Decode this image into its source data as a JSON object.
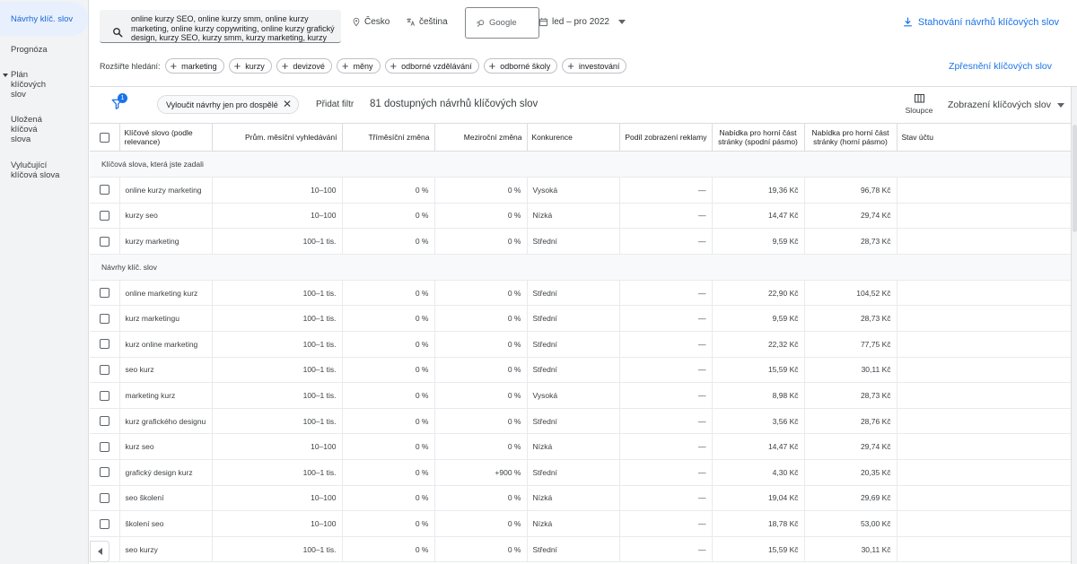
{
  "sidebar": {
    "items": [
      {
        "label": "Návrhy klíč. slov",
        "active": true
      },
      {
        "label": "Prognóza"
      },
      {
        "label": "Plán klíčových slov"
      },
      {
        "label": "Uložená klíčová slova"
      },
      {
        "label": "Vylučující klíčová slova"
      }
    ]
  },
  "header": {
    "keywords": "online kurzy SEO, online kurzy smm, online kurzy marketing, online kurzy copywriting, online kurzy grafický design, kurzy SEO, kurzy smm, kurzy marketing, kurzy",
    "location": "Česko",
    "language": "čeština",
    "network": "Google",
    "date_range": "led – pro 2022",
    "download": "Stahování návrhů klíčových slov",
    "broaden_label": "Rozšiřte hledání:",
    "broaden_chips": [
      "marketing",
      "kurzy",
      "devizové",
      "měny",
      "odborné vzdělávání",
      "odborné školy",
      "investování"
    ],
    "refine": "Zpřesnění klíčových slov"
  },
  "toolbar": {
    "filter_badge": "1",
    "adult_filter": "Vyloučit návrhy jen pro dospělé",
    "add_filter": "Přidat filtr",
    "available": "81 dostupných návrhů klíčových slov",
    "columns": "Sloupce",
    "view": "Zobrazení klíčových slov"
  },
  "table": {
    "headers": {
      "keyword": "Klíčové slovo (podle relevance)",
      "avg": "Prům. měsíční vyhledávání",
      "three_month": "Tříměsíční změna",
      "yoy": "Meziroční změna",
      "competition": "Konkurence",
      "share": "Podíl zobrazení reklamy",
      "bid_low": "Nabídka pro horní část stránky (spodní pásmo)",
      "bid_high": "Nabídka pro horní část stránky (horní pásmo)",
      "status": "Stav účtu"
    },
    "section_entered": "Klíčová slova, která jste zadali",
    "entered_rows": [
      {
        "kw": "online kurzy marketing",
        "avg": "10–100",
        "three": "0 %",
        "yoy": "0 %",
        "comp": "Vysoká",
        "share": "—",
        "low": "19,36 Kč",
        "high": "96,78 Kč"
      },
      {
        "kw": "kurzy seo",
        "avg": "10–100",
        "three": "0 %",
        "yoy": "0 %",
        "comp": "Nízká",
        "share": "—",
        "low": "14,47 Kč",
        "high": "29,74 Kč"
      },
      {
        "kw": "kurzy marketing",
        "avg": "100–1 tis.",
        "three": "0 %",
        "yoy": "0 %",
        "comp": "Střední",
        "share": "—",
        "low": "9,59 Kč",
        "high": "28,73 Kč"
      }
    ],
    "section_ideas": "Návrhy klíč. slov",
    "idea_rows": [
      {
        "kw": "online marketing kurz",
        "avg": "100–1 tis.",
        "three": "0 %",
        "yoy": "0 %",
        "comp": "Střední",
        "share": "—",
        "low": "22,90 Kč",
        "high": "104,52 Kč"
      },
      {
        "kw": "kurz marketingu",
        "avg": "100–1 tis.",
        "three": "0 %",
        "yoy": "0 %",
        "comp": "Střední",
        "share": "—",
        "low": "9,59 Kč",
        "high": "28,73 Kč"
      },
      {
        "kw": "kurz online marketing",
        "avg": "100–1 tis.",
        "three": "0 %",
        "yoy": "0 %",
        "comp": "Střední",
        "share": "—",
        "low": "22,32 Kč",
        "high": "77,75 Kč"
      },
      {
        "kw": "seo kurz",
        "avg": "100–1 tis.",
        "three": "0 %",
        "yoy": "0 %",
        "comp": "Střední",
        "share": "—",
        "low": "15,59 Kč",
        "high": "30,11 Kč"
      },
      {
        "kw": "marketing kurz",
        "avg": "100–1 tis.",
        "three": "0 %",
        "yoy": "0 %",
        "comp": "Vysoká",
        "share": "—",
        "low": "8,98 Kč",
        "high": "28,73 Kč"
      },
      {
        "kw": "kurz grafického designu",
        "avg": "100–1 tis.",
        "three": "0 %",
        "yoy": "0 %",
        "comp": "Střední",
        "share": "—",
        "low": "3,56 Kč",
        "high": "28,76 Kč"
      },
      {
        "kw": "kurz seo",
        "avg": "10–100",
        "three": "0 %",
        "yoy": "0 %",
        "comp": "Nízká",
        "share": "—",
        "low": "14,47 Kč",
        "high": "29,74 Kč"
      },
      {
        "kw": "grafický design kurz",
        "avg": "100–1 tis.",
        "three": "0 %",
        "yoy": "+900 %",
        "comp": "Střední",
        "share": "—",
        "low": "4,30 Kč",
        "high": "20,35 Kč"
      },
      {
        "kw": "seo školení",
        "avg": "10–100",
        "three": "0 %",
        "yoy": "0 %",
        "comp": "Nízká",
        "share": "—",
        "low": "19,04 Kč",
        "high": "29,69 Kč"
      },
      {
        "kw": "školení seo",
        "avg": "10–100",
        "three": "0 %",
        "yoy": "0 %",
        "comp": "Nízká",
        "share": "—",
        "low": "18,78 Kč",
        "high": "53,00 Kč"
      },
      {
        "kw": "seo kurzy",
        "avg": "100–1 tis.",
        "three": "0 %",
        "yoy": "0 %",
        "comp": "Střední",
        "share": "—",
        "low": "15,59 Kč",
        "high": "30,11 Kč"
      }
    ]
  },
  "colors": {
    "accent": "#1a73e8",
    "active_bg": "#e8f0fe",
    "sidebar_bg": "#f1f3f4"
  }
}
